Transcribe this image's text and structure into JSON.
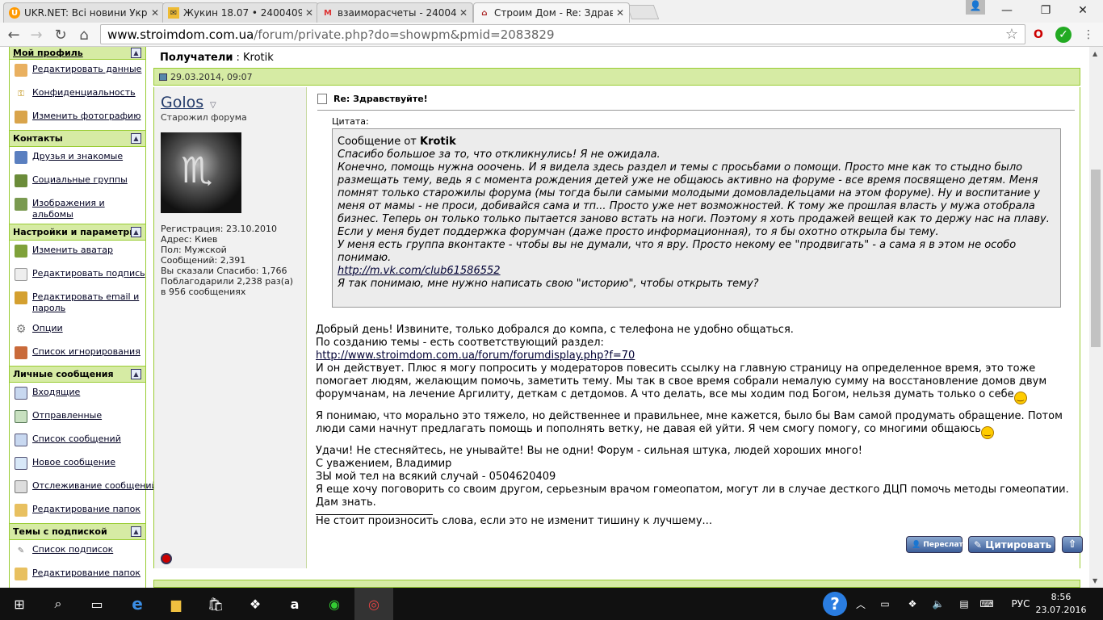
{
  "browser": {
    "tabs": [
      {
        "title": "UKR.NET: Всі новини Укр",
        "icon": "ukrnet-icon"
      },
      {
        "title": "Жукин 18.07 • 2400409@",
        "icon": "mail-icon"
      },
      {
        "title": "взаиморасчеты - 240040",
        "icon": "gmail-icon"
      },
      {
        "title": "Строим Дом - Re: Здравс",
        "icon": "house-icon"
      }
    ],
    "url_domain": "www.stroimdom.com.ua",
    "url_path": "/forum/private.php?do=showpm&pmid=2083829"
  },
  "sidebar": {
    "sections": [
      {
        "title": "Мой профиль",
        "items": [
          "Редактировать данные",
          "Конфиденциальность",
          "Изменить фотографию"
        ]
      },
      {
        "title": "Контакты",
        "items": [
          "Друзья и знакомые",
          "Социальные группы",
          "Изображения и альбомы"
        ]
      },
      {
        "title": "Настройки и параметры",
        "items": [
          "Изменить аватар",
          "Редактировать подпись",
          "Редактировать email и пароль",
          "Опции",
          "Список игнорирования"
        ]
      },
      {
        "title": "Личные сообщения",
        "items": [
          "Входящие",
          "Отправленные",
          "Список сообщений",
          "Новое сообщение",
          "Отслеживание сообщений",
          "Редактирование папок"
        ]
      },
      {
        "title": "Темы с подпиской",
        "items": [
          "Список подписок",
          "Редактирование папок"
        ]
      }
    ]
  },
  "pm": {
    "recipients_label": "Получатели",
    "recipient": "Krotik",
    "date": "29.03.2014, 09:07",
    "title": "Re: Здравствуйте!"
  },
  "user": {
    "name": "Golos",
    "title": "Старожил форума",
    "info": [
      "Регистрация: 23.10.2010",
      "Адрес: Киев",
      "Пол: Мужской",
      "Сообщений: 2,391",
      "Вы сказали Спасибо: 1,766",
      "Поблагодарили 2,238 раз(а)",
      "в 956 сообщениях"
    ]
  },
  "quote": {
    "label": "Цитата:",
    "from_prefix": "Сообщение от",
    "author": "Krotik",
    "lines": [
      "Спасибо большое за то, что откликнулись! Я не ожидала.",
      "Конечно, помощь нужна ооочень. И я видела здесь раздел и темы с просьбами о помощи. Просто мне как то стыдно было размещать тему, ведь я с момента рождения детей уже не общаюсь активно на форуме - все время посвящено детям. Меня помнят только старожилы форума (мы тогда были самыми молодыми домовладельцами на этом форуме). Ну и воспитание у меня от мамы - не проси, добивайся сама и тп... Просто уже нет возможностей. К тому же прошлая власть у мужа отобрала бизнес. Теперь он только только пытается заново встать на ноги. Поэтому я хоть продажей вещей как то держу нас на плаву.",
      "Если у меня будет поддержка форумчан (даже просто информационная), то я бы охотно открыла бы тему.",
      "У меня есть группа вконтакте - чтобы вы не думали, что я вру. Просто некому ее \"продвигать\" - а сама я в этом не особо понимаю."
    ],
    "link": "http://m.vk.com/club61586552",
    "last_line": "Я так понимаю, мне нужно написать свою \"историю\", чтобы открыть тему?"
  },
  "message": {
    "p1a": "Добрый день! Извините, только добрался до компа, с телефона не удобно общаться.",
    "p1b": "По созданию темы - есть соответствующий раздел:",
    "link": "http://www.stroimdom.com.ua/forum/forumdisplay.php?f=70",
    "p1c": "И он действует. Плюс я могу попросить у модераторов повесить ссылку на главную страницу на определенное время, это тоже помогает людям, желающим помочь, заметить тему. Мы так в свое время собрали немалую сумму на восстановление домов двум форумчанам, на лечение Аргилиту, деткам с детдомов. А что делать, все мы ходим под Богом, нельзя думать только о себе",
    "p2": "Я понимаю, что морально это тяжело, но действеннее и правильнее, мне кажется, было бы Вам самой продумать обращение. Потом люди сами начнут предлагать помощь и пополнять ветку, не давая ей уйти. Я чем смогу помогу, со многими общаюсь",
    "p3a": "Удачи! Не стесняйтесь, не унывайте! Вы не одни! Форум - сильная штука, людей хороших много!",
    "p3b": "С уважением, Владимир",
    "p3c": "ЗЫ мой тел на всякий случай - 0504620409",
    "p3d": "Я еще хочу поговорить со своим другом, серьезным врачом гомеопатом, могут ли в случае десткого ДЦП помочь методы гомеопатии. Дам знать.",
    "signature": "Не стоит произносить слова, если это не изменит тишину к лучшему..."
  },
  "buttons": {
    "forward": "Переслать",
    "quote": "Цитировать"
  },
  "taskbar": {
    "lang": "РУС",
    "time": "8:56",
    "date": "23.07.2016"
  },
  "colors": {
    "forum_green": "#d6eba4",
    "forum_border": "#99cc33",
    "button_blue": "#3d5f9a"
  }
}
